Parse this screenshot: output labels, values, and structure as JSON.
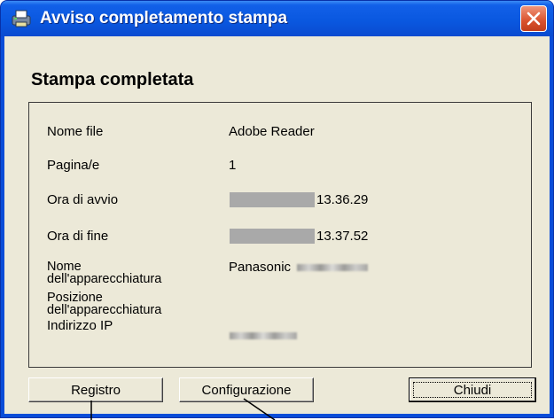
{
  "window": {
    "title": "Avviso completamento stampa",
    "heading": "Stampa completata"
  },
  "fields": [
    {
      "label": "Nome file",
      "value": "Adobe Reader"
    },
    {
      "label": "Pagina/e",
      "value": "1"
    },
    {
      "label": "Ora di avvio",
      "value": "13.36.29"
    },
    {
      "label": "Ora di fine",
      "value": "13.37.52"
    },
    {
      "label": "Nome\ndell'apparecchiatura",
      "value": "Panasonic"
    },
    {
      "label": "Posizione\ndell'apparecchiatura",
      "value": ""
    },
    {
      "label": "Indirizzo IP",
      "value": ""
    }
  ],
  "buttons": {
    "log": "Registro",
    "config": "Configurazione",
    "close": "Chiudi"
  },
  "colors": {
    "titlebar": "#0a58e0",
    "dialog_bg": "#ece9d8",
    "close_button": "#d9522e"
  }
}
